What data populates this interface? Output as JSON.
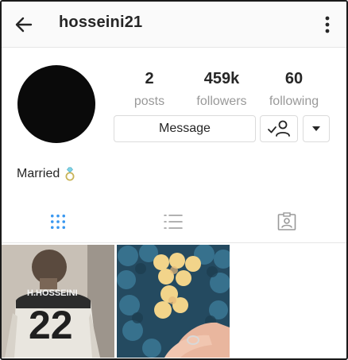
{
  "header": {
    "username": "hosseini21",
    "back_icon": "arrow-left-icon",
    "more_icon": "more-vertical-icon"
  },
  "profile": {
    "stats": {
      "posts": {
        "value": "2",
        "label": "posts"
      },
      "followers": {
        "value": "459k",
        "label": "followers"
      },
      "following": {
        "value": "60",
        "label": "following"
      }
    },
    "message_label": "Message",
    "bio": "Married",
    "bio_emoji": "💍"
  },
  "tabs": [
    {
      "name": "grid",
      "icon": "grid-icon",
      "active": true
    },
    {
      "name": "list",
      "icon": "list-icon",
      "active": false
    },
    {
      "name": "tagged",
      "icon": "tagged-icon",
      "active": false
    }
  ],
  "posts": [
    {
      "jersey_name": "H.HOSSEINI",
      "jersey_number": "22"
    },
    {}
  ],
  "colors": {
    "accent": "#3897f0",
    "text": "#262626",
    "muted": "#999999",
    "border": "#dbdbdb"
  }
}
